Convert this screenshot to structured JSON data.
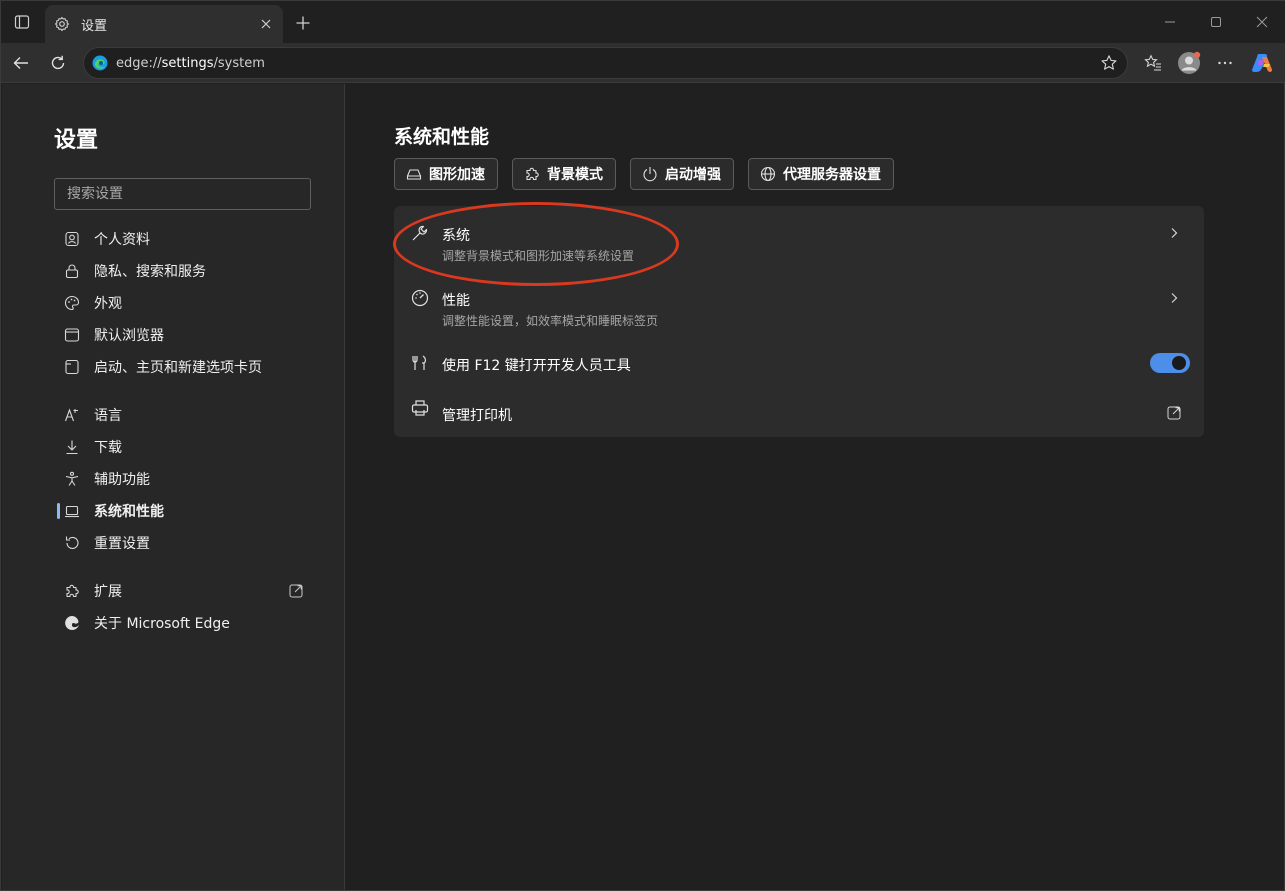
{
  "tab": {
    "title": "设置"
  },
  "address": {
    "scheme": "edge://",
    "host": "settings",
    "path": "/system"
  },
  "sidebar": {
    "title": "设置",
    "search_placeholder": "搜索设置",
    "items": [
      {
        "label": "个人资料",
        "icon": "profile-icon"
      },
      {
        "label": "隐私、搜索和服务",
        "icon": "lock-icon"
      },
      {
        "label": "外观",
        "icon": "palette-icon"
      },
      {
        "label": "默认浏览器",
        "icon": "browser-icon"
      },
      {
        "label": "启动、主页和新建选项卡页",
        "icon": "home-page-icon"
      },
      {
        "label": "语言",
        "icon": "language-icon"
      },
      {
        "label": "下载",
        "icon": "download-icon"
      },
      {
        "label": "辅助功能",
        "icon": "accessibility-icon"
      },
      {
        "label": "系统和性能",
        "icon": "laptop-icon",
        "selected": true
      },
      {
        "label": "重置设置",
        "icon": "reset-icon"
      },
      {
        "label": "扩展",
        "icon": "puzzle-icon"
      },
      {
        "label": "关于 Microsoft Edge",
        "icon": "edge-logo-icon"
      }
    ]
  },
  "main": {
    "title": "系统和性能",
    "quick_buttons": [
      {
        "label": "图形加速",
        "icon": "hard-drive-icon"
      },
      {
        "label": "背景模式",
        "icon": "puzzle-icon"
      },
      {
        "label": "启动增强",
        "icon": "power-icon"
      },
      {
        "label": "代理服务器设置",
        "icon": "globe-icon"
      }
    ],
    "rows": {
      "system": {
        "title": "系统",
        "subtitle": "调整背景模式和图形加速等系统设置"
      },
      "performance": {
        "title": "性能",
        "subtitle": "调整性能设置，如效率模式和睡眠标签页"
      },
      "devtools": {
        "title": "使用 F12 键打开开发人员工具",
        "enabled": true
      },
      "printers": {
        "title": "管理打印机"
      }
    }
  },
  "colors": {
    "accent": "#4c8ee8",
    "annotation": "#d9391e",
    "selected_bar": "#8fb8f0"
  }
}
